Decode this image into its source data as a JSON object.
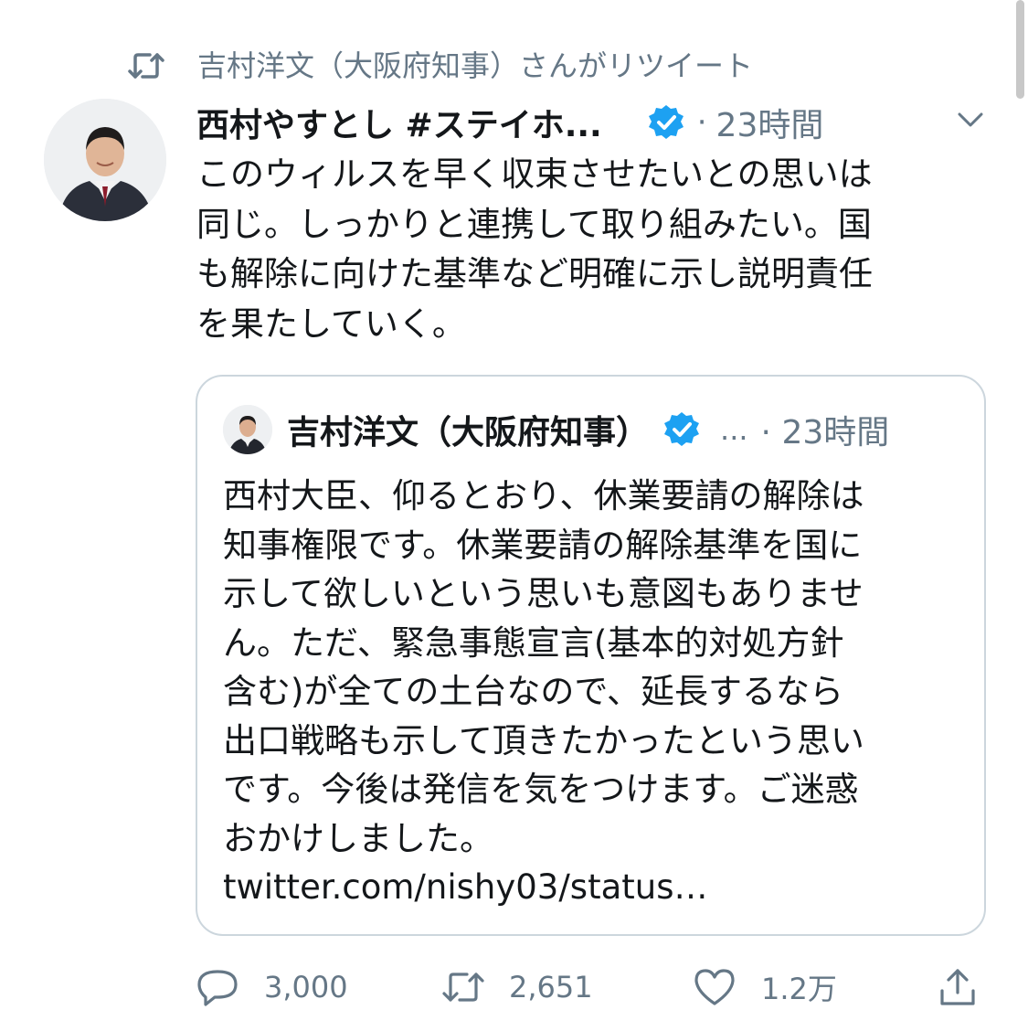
{
  "retweet_context": {
    "text": "吉村洋文（大阪府知事）さんがリツイート",
    "icon": "retweet-icon"
  },
  "tweet": {
    "author_name": "西村やすとし #ステイホ...",
    "verified": true,
    "time": "23時間",
    "separator": "·",
    "text_lines": [
      "このウィルスを早く収束させたいとの思いは",
      "同じ。しっかりと連携して取り組みたい。国",
      "も解除に向けた基準など明確に示し説明責任",
      "を果たしていく。"
    ]
  },
  "quote": {
    "author_name": "吉村洋文（大阪府知事）",
    "verified": true,
    "handle_ellipsis": "...",
    "separator": "·",
    "time": "23時間",
    "text_lines": [
      "西村大臣、仰るとおり、休業要請の解除は",
      "知事権限です。休業要請の解除基準を国に",
      "示して欲しいという思いも意図もありませ",
      "ん。ただ、緊急事態宣言(基本的対処方針",
      "含む)が全ての土台なので、延長するなら",
      "出口戦略も示して頂きたかったという思い",
      "です。今後は発信を気をつけます。ご迷惑",
      "おかけしました。"
    ],
    "link": "twitter.com/nishy03/status…"
  },
  "actions": {
    "reply": {
      "icon": "reply-icon",
      "count": "3,000"
    },
    "retweet": {
      "icon": "retweet-icon",
      "count": "2,651"
    },
    "like": {
      "icon": "heart-icon",
      "count": "1.2万"
    },
    "share": {
      "icon": "share-icon"
    }
  },
  "colors": {
    "text": "#14171a",
    "secondary": "#657786",
    "verified": "#1da1f2",
    "border": "#ccd6dd"
  }
}
